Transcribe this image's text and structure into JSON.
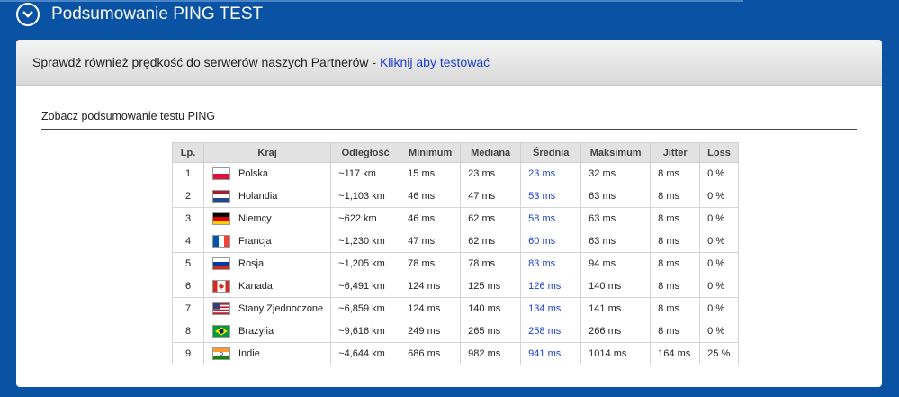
{
  "header": {
    "title": "Podsumowanie PING TEST"
  },
  "banner": {
    "text": "Sprawdź również prędkość do serwerów naszych Partnerów - ",
    "link": "Kliknij aby testować"
  },
  "section_title": "Zobacz podsumowanie testu PING",
  "table": {
    "headers": [
      "Lp.",
      "Kraj",
      "Odległość",
      "Minimum",
      "Mediana",
      "Średnia",
      "Maksimum",
      "Jitter",
      "Loss"
    ],
    "rows": [
      {
        "lp": "1",
        "country": "Polska",
        "flag": "poland-flag",
        "distance": "~117 km",
        "min": "15 ms",
        "median": "23 ms",
        "avg": "23 ms",
        "max": "32 ms",
        "jitter": "8 ms",
        "loss": "0 %"
      },
      {
        "lp": "2",
        "country": "Holandia",
        "flag": "netherlands-flag",
        "distance": "~1,103 km",
        "min": "46 ms",
        "median": "47 ms",
        "avg": "53 ms",
        "max": "63 ms",
        "jitter": "8 ms",
        "loss": "0 %"
      },
      {
        "lp": "3",
        "country": "Niemcy",
        "flag": "germany-flag",
        "distance": "~622 km",
        "min": "46 ms",
        "median": "62 ms",
        "avg": "58 ms",
        "max": "63 ms",
        "jitter": "8 ms",
        "loss": "0 %"
      },
      {
        "lp": "4",
        "country": "Francja",
        "flag": "france-flag",
        "distance": "~1,230 km",
        "min": "47 ms",
        "median": "62 ms",
        "avg": "60 ms",
        "max": "63 ms",
        "jitter": "8 ms",
        "loss": "0 %"
      },
      {
        "lp": "5",
        "country": "Rosja",
        "flag": "russia-flag",
        "distance": "~1,205 km",
        "min": "78 ms",
        "median": "78 ms",
        "avg": "83 ms",
        "max": "94 ms",
        "jitter": "8 ms",
        "loss": "0 %"
      },
      {
        "lp": "6",
        "country": "Kanada",
        "flag": "canada-flag",
        "distance": "~6,491 km",
        "min": "124 ms",
        "median": "125 ms",
        "avg": "126 ms",
        "max": "140 ms",
        "jitter": "8 ms",
        "loss": "0 %"
      },
      {
        "lp": "7",
        "country": "Stany Zjednoczone",
        "flag": "usa-flag",
        "distance": "~6,859 km",
        "min": "124 ms",
        "median": "140 ms",
        "avg": "134 ms",
        "max": "141 ms",
        "jitter": "8 ms",
        "loss": "0 %"
      },
      {
        "lp": "8",
        "country": "Brazylia",
        "flag": "brazil-flag",
        "distance": "~9,616 km",
        "min": "249 ms",
        "median": "265 ms",
        "avg": "258 ms",
        "max": "266 ms",
        "jitter": "8 ms",
        "loss": "0 %"
      },
      {
        "lp": "9",
        "country": "Indie",
        "flag": "india-flag",
        "distance": "~4,644 km",
        "min": "686 ms",
        "median": "982 ms",
        "avg": "941 ms",
        "max": "1014 ms",
        "jitter": "164 ms",
        "loss": "25 %"
      }
    ]
  },
  "colors": {
    "background": "#0a52a4",
    "link": "#1a3fd0",
    "header_bg": "#e2e2e2"
  }
}
